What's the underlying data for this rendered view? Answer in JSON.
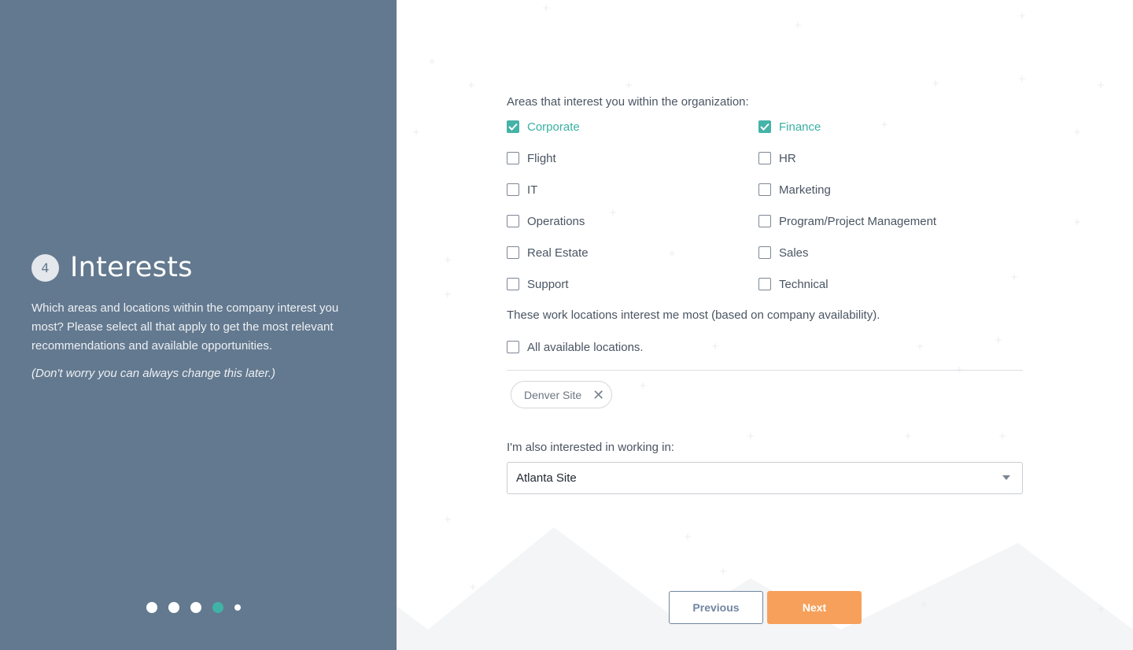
{
  "left": {
    "step_number": "4",
    "step_title": "Interests",
    "description": "Which areas and locations within the company interest you most? Please select all that apply to get the most relevant recommendations and available opportunities.",
    "note": "(Don't worry you can always change this later.)",
    "pager": {
      "total": 5,
      "current": 4
    }
  },
  "form": {
    "areas_question": "Areas that interest you within the organization:",
    "areas": [
      {
        "label": "Corporate",
        "checked": true
      },
      {
        "label": "Finance",
        "checked": true
      },
      {
        "label": "Flight",
        "checked": false
      },
      {
        "label": "HR",
        "checked": false
      },
      {
        "label": "IT",
        "checked": false
      },
      {
        "label": "Marketing",
        "checked": false
      },
      {
        "label": "Operations",
        "checked": false
      },
      {
        "label": "Program/Project Management",
        "checked": false
      },
      {
        "label": "Real Estate",
        "checked": false
      },
      {
        "label": "Sales",
        "checked": false
      },
      {
        "label": "Support",
        "checked": false
      },
      {
        "label": "Technical",
        "checked": false
      }
    ],
    "locations_question": "These work locations interest me most (based on company availability).",
    "all_locations": {
      "label": "All available locations.",
      "checked": false
    },
    "selected_locations": [
      {
        "label": "Denver Site",
        "remove_icon": "close-icon"
      }
    ],
    "also_interested_label": "I'm also interested in working in:",
    "also_interested_value": "Atlanta Site"
  },
  "buttons": {
    "previous": "Previous",
    "next": "Next"
  },
  "colors": {
    "sidebar": "#63798f",
    "accent": "#45b3a7",
    "next_button": "#f7a05b",
    "pager_active": "#40b3a6"
  }
}
